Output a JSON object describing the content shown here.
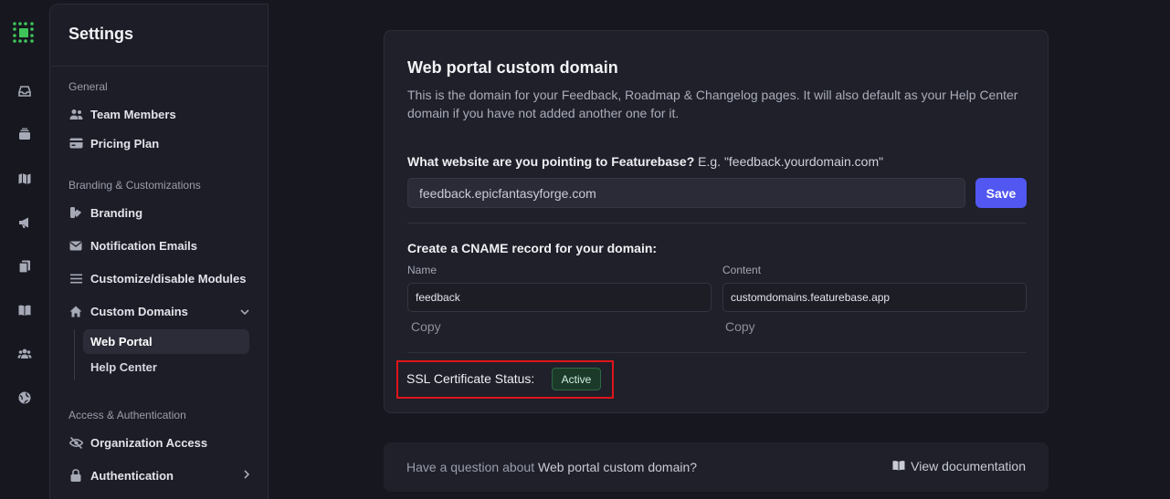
{
  "sidebar": {
    "title": "Settings",
    "sections": {
      "general": "General",
      "branding": "Branding & Customizations",
      "access": "Access & Authentication"
    },
    "items": {
      "team_members": "Team Members",
      "pricing_plan": "Pricing Plan",
      "branding": "Branding",
      "notification_emails": "Notification Emails",
      "customize_modules": "Customize/disable Modules",
      "custom_domains": "Custom Domains",
      "web_portal": "Web Portal",
      "help_center": "Help Center",
      "organization_access": "Organization Access",
      "authentication": "Authentication"
    }
  },
  "card": {
    "title": "Web portal custom domain",
    "description": "This is the domain for your Feedback, Roadmap & Changelog pages. It will also default as your Help Center domain if you have not added another one for it.",
    "question": "What website are you pointing to Featurebase?",
    "example": "E.g. \"feedback.yourdomain.com\"",
    "domain_value": "feedback.epicfantasyforge.com",
    "save_label": "Save",
    "cname_title": "Create a CNAME record for your domain:",
    "name_label": "Name",
    "content_label": "Content",
    "name_value": "feedback",
    "content_value": "customdomains.featurebase.app",
    "copy_label": "Copy",
    "ssl_label": "SSL Certificate Status:",
    "ssl_status": "Active"
  },
  "help": {
    "prefix": "Have a question about ",
    "topic": "Web portal custom domain?",
    "doc_link": "View documentation"
  },
  "colors": {
    "accent": "#5157f0",
    "highlight": "#e0141b",
    "badge_bg": "#1c3a2a"
  }
}
